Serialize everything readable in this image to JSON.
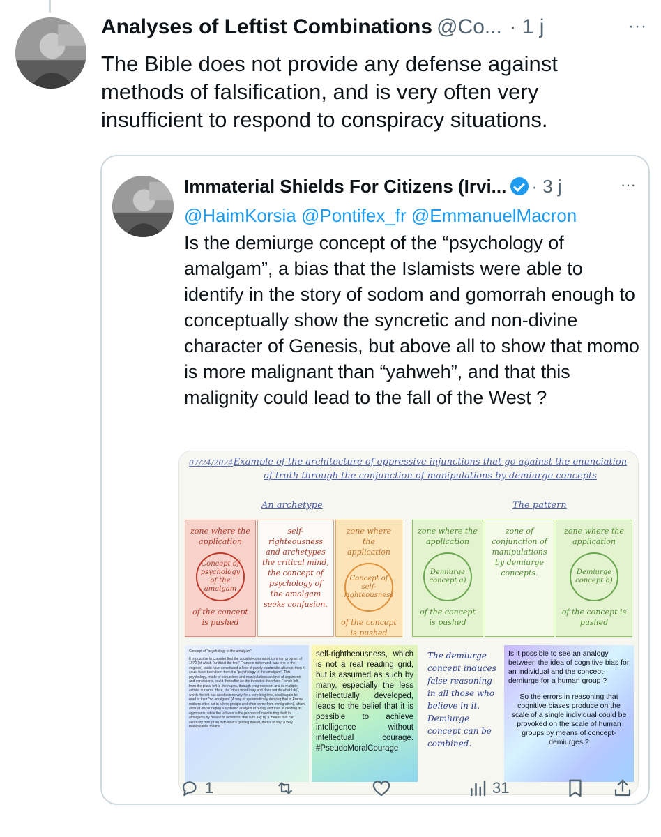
{
  "tweet": {
    "author": "Analyses of Leftist Combinations",
    "handle": "@Co...",
    "time": "· 1 j",
    "more": "···",
    "text": "The Bible does not provide any defense against methods of falsification, and is very often very insufficient to respond to conspiracy situations."
  },
  "quote": {
    "author": "Immaterial Shields For Citizens (Irvi...",
    "handle": "· 3 j",
    "more": "···",
    "mentions": "@HaimKorsia @Pontifex_fr @EmmanuelMacron",
    "text": "Is the demiurge concept of the “psychology of amalgam”, a bias that the Islamists were able to identify in the story of sodom and gomorrah enough to conceptually show the syncretic and non-divine character of Genesis, but above all to show that momo is more malignant than “yahweh”, and that this malignity could lead to the fall of the West ?"
  },
  "media": {
    "date": "07/24/2024",
    "title": "Example of the architecture of oppressive injunctions that go against the enunciation of truth through the conjunction of manipulations by demiurge concepts",
    "archetype_label": "An archetype",
    "pattern_label": "The pattern",
    "panels": {
      "p1_top": "zone where the application",
      "p1_circle": "Concept of psychology of the amalgam",
      "p1_bottom": "of the concept is pushed",
      "p2_text": "self-righteousness and archetypes the critical mind, the concept of psychology of the amalgam seeks confusion.",
      "p3_top": "zone where the application",
      "p3_circle": "Concept of self-righteousness",
      "p3_bottom": "of the concept is pushed",
      "p4_top": "zone where the application",
      "p4_circle": "Demiurge concept a)",
      "p4_bottom": "of the concept is pushed",
      "p5_text": "zone of conjunction of manipulations by demiurge concepts.",
      "p6_top": "zone where the application",
      "p6_circle": "Demiurge concept b)",
      "p6_bottom": "of the concept is pushed"
    },
    "box_small_title": "Concept of \"psychology of the amalgam\"",
    "box_small_text": "It is possible to consider that the socialist-communist common program of 1972 (of which \"Artificial the first\" Francois mitterrand, was one of the engines) could have constituted a kind of purely electoralist alliance, then it could have been born from it a \"psychology of the amalgam\". This psychology, made of seductions and manipulations and not of arguments and convictions, could thereafter be the thread of the whole French left, from the plural left to the nupes, through progressivism and its multiple activist currents. Here, the \"does what I say and does not do what I do\", which the left has used extensively for a very long time, could again be read in their \"no amalgam\" (A way of systematically denying that in France robbers often act in ethnic groups and often come from immigration), which aims at discouraging a systemic analysis of reality and thus at dividing its opponents, while the left was in the process of constituting itself in amalgams by means of activisms, that is to say by a means that can seriously disrupt an individual's guiding thread, that is to say, a very manipulative means.",
    "box_self": "self-rightheousness, which is not a real reading grid, but is assumed as such by many, especially the less intellectually developed, leads to the belief that it is possible to achieve intelligence without intellectual courage. #PseudoMoralCourage",
    "box_hand": "The demiurge concept induces false reasoning in all those who believe in it. Demiurge concept can be combined.",
    "box_analogy_1": "Is it possible to see an analogy between the idea of cognitive bias for an individual and the concept-demiurge for a human group ?",
    "box_analogy_2": "So the errors in reasoning that cognitive biases produce on the scale of a single individual could be provoked on the scale of human groups by means of concept-demiurges ?"
  },
  "actions": {
    "reply_count": "1",
    "retweet_count": "",
    "like_count": "",
    "views_count": "31"
  },
  "colors": {
    "text": "#0f1419",
    "secondary": "#536471",
    "link": "#1d9bf0",
    "border": "#cfd9de"
  }
}
